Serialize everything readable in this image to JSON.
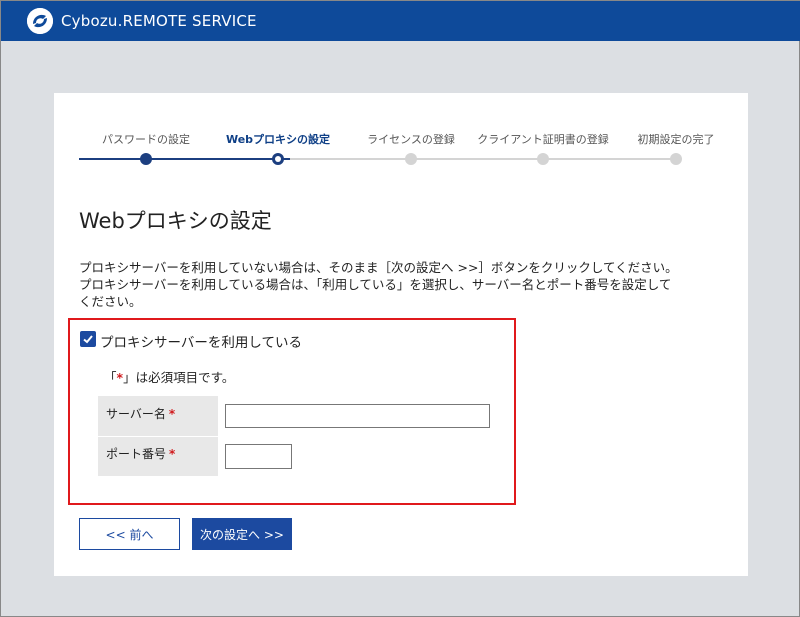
{
  "app": {
    "title": "Cybozu.REMOTE SERVICE",
    "brand_color": "#0e4a9a"
  },
  "steps": [
    {
      "label": "パスワードの設定",
      "state": "done"
    },
    {
      "label": "Webプロキシの設定",
      "state": "current"
    },
    {
      "label": "ライセンスの登録",
      "state": "todo"
    },
    {
      "label": "クライアント証明書の登録",
      "state": "todo"
    },
    {
      "label": "初期設定の完了",
      "state": "todo"
    }
  ],
  "main": {
    "title": "Webプロキシの設定",
    "desc_line1": "プロキシサーバーを利用していない場合は、そのまま［次の設定へ >>］ボタンをクリックしてください。",
    "desc_line2": "プロキシサーバーを利用している場合は、「利用している」を選択し、サーバー名とポート番号を設定して",
    "desc_line3": "ください。"
  },
  "form": {
    "use_proxy_label": "プロキシサーバーを利用している",
    "use_proxy_checked": true,
    "required_note_prefix": "「",
    "required_mark": "*",
    "required_note_suffix": "」は必須項目です。",
    "server_name_label": "サーバー名",
    "server_name_value": "",
    "port_label": "ポート番号",
    "port_value": "",
    "highlight_color": "#e0191c"
  },
  "buttons": {
    "back_label": "<< 前へ",
    "next_label": "次の設定へ >>"
  }
}
